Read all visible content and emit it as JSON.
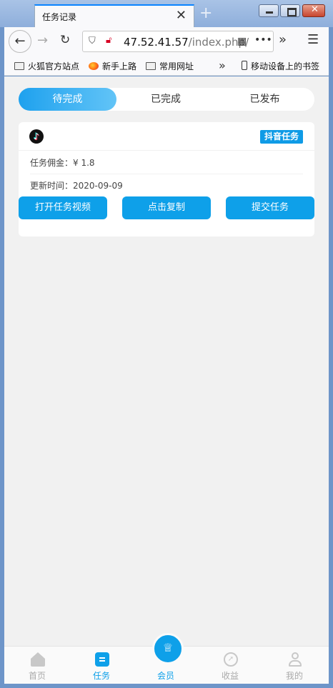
{
  "browser": {
    "tab_title": "任务记录",
    "tab_close": "✕",
    "new_tab": "+",
    "url_host": "47.52.41.57",
    "url_path": "/index.php/",
    "bookmarks": [
      {
        "label": "火狐官方站点",
        "icon": "folder-icon"
      },
      {
        "label": "新手上路",
        "icon": "firefox-icon"
      },
      {
        "label": "常用网址",
        "icon": "folder-icon"
      },
      {
        "label": "移动设备上的书签",
        "icon": "phone-icon"
      }
    ]
  },
  "tabs": [
    {
      "label": "待完成"
    },
    {
      "label": "已完成"
    },
    {
      "label": "已发布"
    }
  ],
  "task_card": {
    "platform_icon": "tiktok-icon",
    "badge": "抖音任务",
    "commission": "任务佣金：¥ 1.8",
    "updated": "更新时间：2020-09-09",
    "buttons": [
      "打开任务视频",
      "点击复制",
      "提交任务"
    ]
  },
  "tabbar": {
    "items": [
      {
        "label": "首页"
      },
      {
        "label": "任务"
      },
      {
        "label": "会员"
      },
      {
        "label": "收益"
      },
      {
        "label": "我的"
      }
    ]
  },
  "colors": {
    "accent": "#0ea0e9",
    "page_bg": "#f1f1f1"
  }
}
